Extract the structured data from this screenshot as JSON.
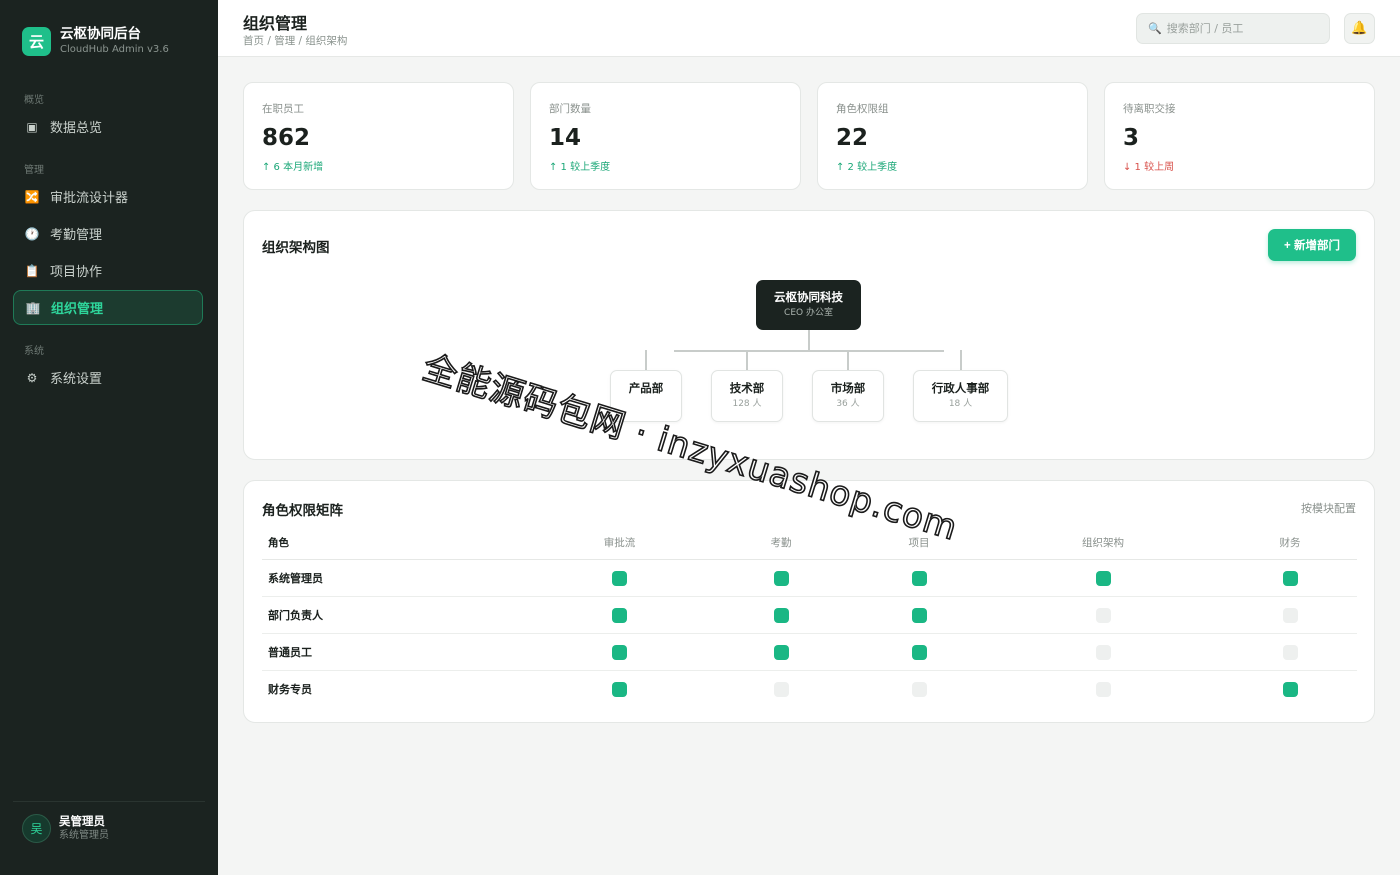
{
  "sidebar": {
    "brand": {
      "logo_char": "云",
      "name": "云枢协同后台",
      "sub": "CloudHub Admin v3.6"
    },
    "sections": [
      {
        "title": "概览",
        "items": [
          {
            "icon": "dashboard-icon",
            "glyph": "▣",
            "label": "数据总览"
          }
        ]
      },
      {
        "title": "管理",
        "items": [
          {
            "icon": "workflow-icon",
            "glyph": "🔀",
            "label": "审批流设计器"
          },
          {
            "icon": "clock-icon",
            "glyph": "🕐",
            "label": "考勤管理"
          },
          {
            "icon": "clipboard-icon",
            "glyph": "📋",
            "label": "项目协作"
          },
          {
            "icon": "building-icon",
            "glyph": "🏢",
            "label": "组织管理",
            "active": true
          }
        ]
      },
      {
        "title": "系统",
        "items": [
          {
            "icon": "gear-icon",
            "glyph": "⚙",
            "label": "系统设置"
          }
        ]
      }
    ],
    "user": {
      "avatar_char": "吴",
      "name": "吴管理员",
      "role": "系统管理员"
    }
  },
  "header": {
    "title": "组织管理",
    "breadcrumb": "首页 / 管理 / 组织架构",
    "search": {
      "placeholder": "搜索部门 / 员工",
      "value": ""
    },
    "bell_icon": "bell-icon"
  },
  "stats": [
    {
      "label": "在职员工",
      "value": "862",
      "trend": "↑ 6 本月新增",
      "direction": "up"
    },
    {
      "label": "部门数量",
      "value": "14",
      "trend": "↑ 1 较上季度",
      "direction": "up"
    },
    {
      "label": "角色权限组",
      "value": "22",
      "trend": "↑ 2 较上季度",
      "direction": "up"
    },
    {
      "label": "待离职交接",
      "value": "3",
      "trend": "↓ 1 较上周",
      "direction": "down"
    }
  ],
  "org": {
    "title": "组织架构图",
    "add_label": "+ 新增部门",
    "root": {
      "name": "云枢协同科技",
      "sub": "CEO 办公室"
    },
    "departments": [
      {
        "name": "产品部",
        "count": ""
      },
      {
        "name": "技术部",
        "count": "128 人"
      },
      {
        "name": "市场部",
        "count": "36 人"
      },
      {
        "name": "行政人事部",
        "count": "18 人"
      }
    ]
  },
  "permissions": {
    "title": "角色权限矩阵",
    "config_label": "按模块配置",
    "columns": [
      "角色",
      "审批流",
      "考勤",
      "项目",
      "组织架构",
      "财务"
    ],
    "rows": [
      {
        "role": "系统管理员",
        "grants": [
          true,
          true,
          true,
          true,
          true
        ]
      },
      {
        "role": "部门负责人",
        "grants": [
          true,
          true,
          true,
          false,
          false
        ]
      },
      {
        "role": "普通员工",
        "grants": [
          true,
          true,
          true,
          false,
          false
        ]
      },
      {
        "role": "财务专员",
        "grants": [
          true,
          false,
          false,
          false,
          true
        ]
      }
    ]
  },
  "colors": {
    "accent": "#1fbf8a",
    "sidebar_bg": "#1b2320",
    "trend_up": "#1aa777",
    "trend_down": "#d8504a"
  },
  "watermark": "全能源码包网 · inzyxuashop.com"
}
